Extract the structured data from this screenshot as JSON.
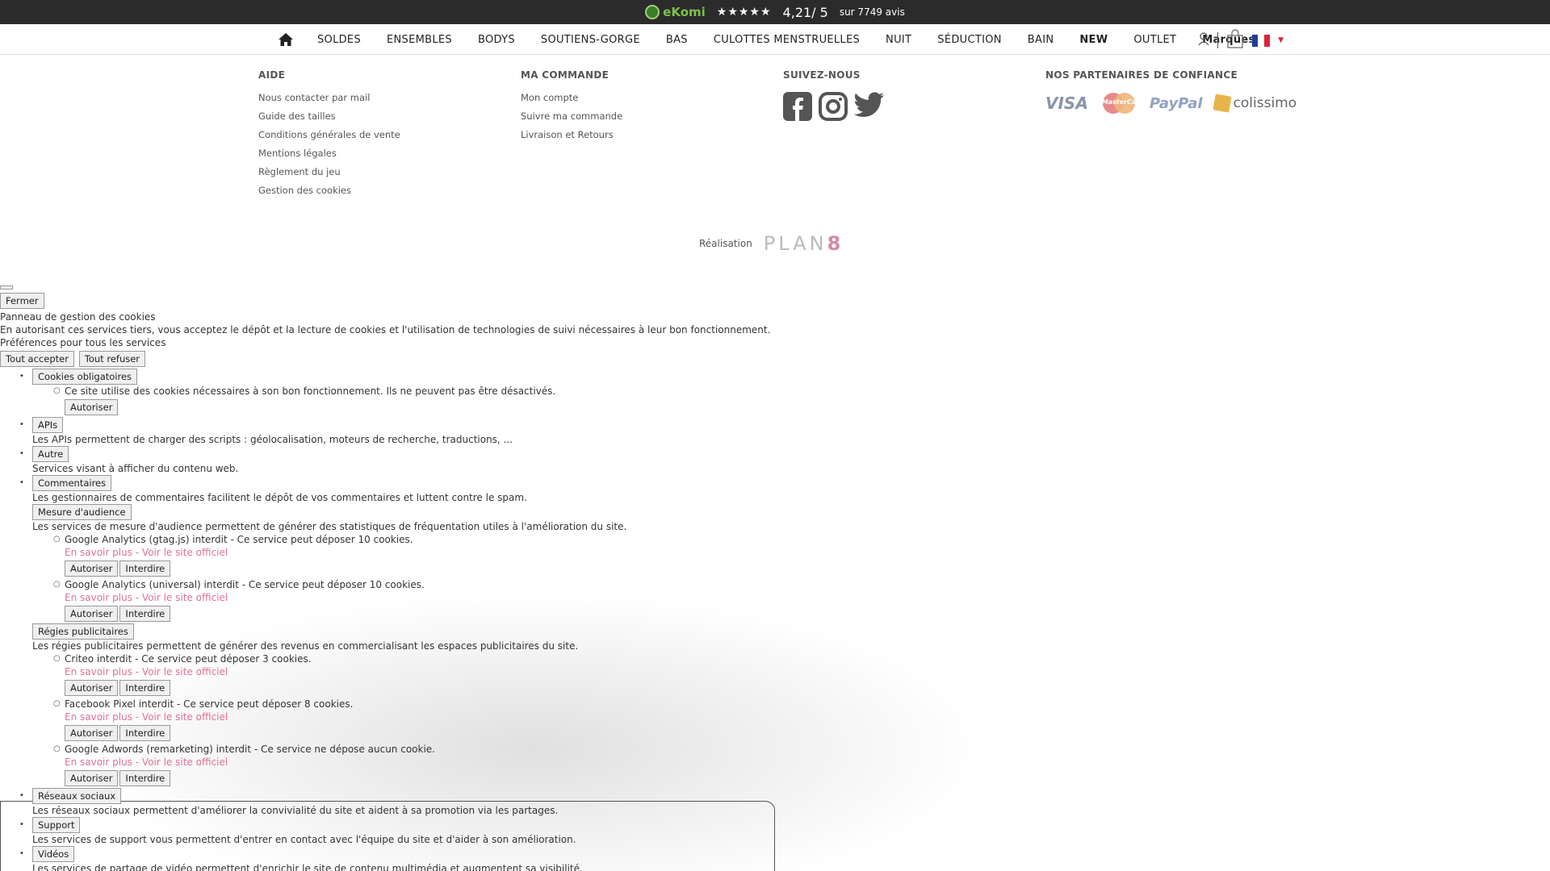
{
  "topbar": {
    "ekomi_label": "eKomi",
    "stars": "★★★★★",
    "score": "4,21/ 5",
    "reviews": "sur 7749 avis"
  },
  "nav": {
    "items": [
      "SOLDES",
      "ENSEMBLES",
      "BODYS",
      "SOUTIENS-GORGE",
      "BAS",
      "CULOTTES MENSTRUELLES",
      "NUIT",
      "SÉDUCTION",
      "BAIN",
      "NEW",
      "OUTLET",
      "Marques"
    ]
  },
  "footer": {
    "aide": {
      "title": "AIDE",
      "links": [
        "Nous contacter par mail",
        "Guide des tailles",
        "Conditions générales de vente",
        "Mentions légales",
        "Règlement du jeu",
        "Gestion des cookies"
      ]
    },
    "commande": {
      "title": "MA COMMANDE",
      "links": [
        "Mon compte",
        "Suivre ma commande",
        "Livraison et Retours"
      ]
    },
    "suivez": {
      "title": "SUIVEZ-NOUS"
    },
    "partenaires": {
      "title": "NOS PARTENAIRES DE CONFIANCE",
      "visa": "VISA",
      "mastercard": "MasterCard",
      "paypal": "PayPal",
      "colissimo": "colissimo"
    },
    "realisation": "Réalisation",
    "plan8_text": "PLAN",
    "plan8_num": "8"
  },
  "cookies": {
    "close": "Fermer",
    "title": "Panneau de gestion des cookies",
    "intro": "En autorisant ces services tiers, vous acceptez le dépôt et la lecture de cookies et l'utilisation de technologies de suivi nécessaires à leur bon fonctionnement.",
    "prefs": "Préférences pour tous les services",
    "accept_all": "Tout accepter",
    "refuse_all": "Tout refuser",
    "allow": "Autoriser",
    "deny": "Interdire",
    "more": "En savoir plus",
    "sep": " - ",
    "site": "Voir le site officiel",
    "mandatory": {
      "label": "Cookies obligatoires",
      "desc": "Ce site utilise des cookies nécessaires à son bon fonctionnement. Ils ne peuvent pas être désactivés."
    },
    "apis": {
      "label": "APIs",
      "desc": "Les APIs permettent de charger des scripts : géolocalisation, moteurs de recherche, traductions, ..."
    },
    "autre": {
      "label": "Autre",
      "desc": "Services visant à afficher du contenu web."
    },
    "commentaires": {
      "label": "Commentaires",
      "desc": "Les gestionnaires de commentaires facilitent le dépôt de vos commentaires et luttent contre le spam."
    },
    "audience": {
      "label": "Mesure d'audience",
      "desc": "Les services de mesure d'audience permettent de générer des statistiques de fréquentation utiles à l'amélioration du site.",
      "services": [
        "Google Analytics (gtag.js) interdit - Ce service peut déposer 10 cookies.",
        "Google Analytics (universal) interdit - Ce service peut déposer 10 cookies."
      ]
    },
    "regies": {
      "label": "Régies publicitaires",
      "desc": "Les régies publicitaires permettent de générer des revenus en commercialisant les espaces publicitaires du site.",
      "services": [
        "Criteo interdit - Ce service peut déposer 3 cookies.",
        "Facebook Pixel interdit - Ce service peut déposer 8 cookies.",
        "Google Adwords (remarketing) interdit - Ce service ne dépose aucun cookie."
      ]
    },
    "reseaux": {
      "label": "Réseaux sociaux",
      "desc": "Les réseaux sociaux permettent d'améliorer la convivialité du site et aident à sa promotion via les partages."
    },
    "support": {
      "label": "Support",
      "desc": "Les services de support vous permettent d'entrer en contact avec l'équipe du site et d'aider à son amélioration."
    },
    "videos": {
      "label": "Vidéos",
      "desc": "Les services de partage de vidéo permettent d'enrichir le site de contenu multimédia et augmentent sa visibilité."
    }
  }
}
